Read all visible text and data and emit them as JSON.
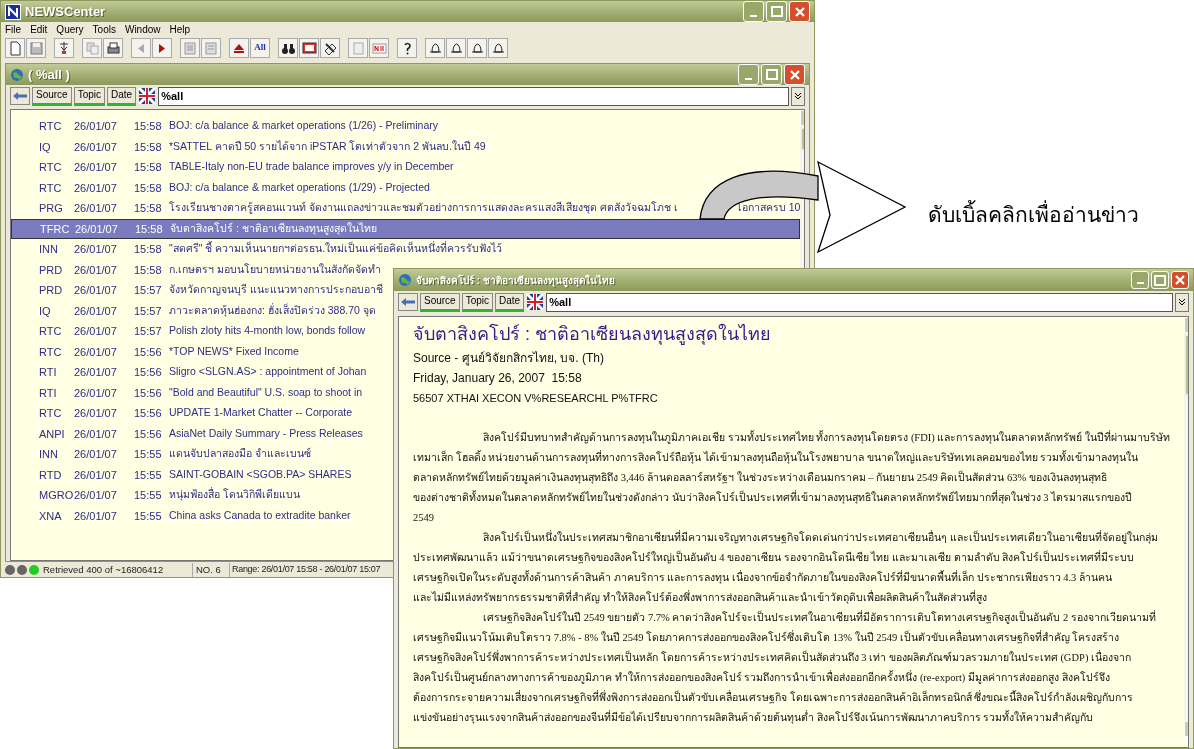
{
  "app": {
    "title": "NEWSCenter",
    "menu": [
      "File",
      "Edit",
      "Query",
      "Tools",
      "Window",
      "Help"
    ],
    "toolbar_label": "All"
  },
  "list_window": {
    "title": "( %all )",
    "filter_buttons": [
      "Source",
      "Topic",
      "Date"
    ],
    "query": "%all",
    "rows": [
      {
        "source": "RTC",
        "date": "26/01/07",
        "time": "15:58",
        "title": "BOJ: c/a balance & market operations (1/26) - Preliminary",
        "selected": false
      },
      {
        "source": "IQ",
        "date": "26/01/07",
        "time": "15:58",
        "title": "*SATTEL คาดปี 50 รายได้จาก iPSTAR โตเท่าตัวจาก 2 พันลบ.ในปี 49",
        "selected": false
      },
      {
        "source": "RTC",
        "date": "26/01/07",
        "time": "15:58",
        "title": "TABLE-Italy non-EU trade balance improves y/y in December",
        "selected": false
      },
      {
        "source": "RTC",
        "date": "26/01/07",
        "time": "15:58",
        "title": "BOJ: c/a balance & market operations (1/29) - Projected",
        "selected": false
      },
      {
        "source": "PRG",
        "date": "26/01/07",
        "time": "15:58",
        "title": "โรงเรียนชางตาครู้สคอนแวนท์ จัดงานแถลงข่าวและชมตัวอย่างการการแสดงละครแสงสีเสียงชุด ศตสังวัจฉมโภช เ",
        "title_tail": "โอกาสครบ 10",
        "selected": false
      },
      {
        "source": "TFRC",
        "date": "26/01/07",
        "time": "15:58",
        "title": "จับตาสิงคโปร์ : ชาติอาเซียนลงทุนสูงสุดในไทย",
        "selected": true
      },
      {
        "source": "INN",
        "date": "26/01/07",
        "time": "15:58",
        "title": "\"สดศรี\" ชี้ ความเห็นนายกฯต่อรธน.ใหม่เป็นแค่ข้อคิดเห็นหนึ่งที่ควรรับฟังไว้",
        "selected": false
      },
      {
        "source": "PRD",
        "date": "26/01/07",
        "time": "15:58",
        "title": "ก.เกษตรฯ มอบนโยบายหน่วยงานในสังกัดจัดทำ",
        "selected": false
      },
      {
        "source": "PRD",
        "date": "26/01/07",
        "time": "15:57",
        "title": "จังหวัดกาญจนบุรี แนะแนวทางการประกอบอาชี",
        "selected": false
      },
      {
        "source": "IQ",
        "date": "26/01/07",
        "time": "15:57",
        "title": "ภาวะตลาดหุ้นฮ่องกง: ฮั่งเส็งปิดร่วง 388.70 จุด",
        "selected": false
      },
      {
        "source": "RTC",
        "date": "26/01/07",
        "time": "15:57",
        "title": "Polish zloty hits 4-month low, bonds follow",
        "selected": false
      },
      {
        "source": "RTC",
        "date": "26/01/07",
        "time": "15:56",
        "title": "*TOP NEWS* Fixed Income",
        "selected": false
      },
      {
        "source": "RTI",
        "date": "26/01/07",
        "time": "15:56",
        "title": "Sligro <SLGN.AS> : appointment of Johan",
        "selected": false
      },
      {
        "source": "RTI",
        "date": "26/01/07",
        "time": "15:56",
        "title": "\"Bold and Beautiful\" U.S. soap to shoot in",
        "selected": false
      },
      {
        "source": "RTC",
        "date": "26/01/07",
        "time": "15:56",
        "title": "UPDATE 1-Market Chatter -- Corporate",
        "selected": false
      },
      {
        "source": "ANPI",
        "date": "26/01/07",
        "time": "15:56",
        "title": "AsiaNet Daily Summary - Press Releases",
        "selected": false
      },
      {
        "source": "INN",
        "date": "26/01/07",
        "time": "15:55",
        "title": "แดนจับปลาสองมือ จำและเบนซ์",
        "selected": false
      },
      {
        "source": "RTD",
        "date": "26/01/07",
        "time": "15:55",
        "title": "SAINT-GOBAIN <SGOB.PA> SHARES",
        "selected": false
      },
      {
        "source": "MGRO",
        "date": "26/01/07",
        "time": "15:55",
        "title": "หนุ่มฟ้องสื่อ โดนวิกิพีเดียแบน",
        "selected": false
      },
      {
        "source": "XNA",
        "date": "26/01/07",
        "time": "15:55",
        "title": "China asks Canada to extradite banker",
        "selected": false
      }
    ]
  },
  "status_bar": {
    "retrieved": "Retrieved 400 of ~16806412",
    "number": "NO. 6",
    "range": "Range: 26/01/07 15:58 - 26/01/07 15:07"
  },
  "callout": "ดับเบิ้ลคลิกเพื่ออ่านข่าว",
  "article_window": {
    "title": "จับตาสิงคโปร์ : ชาติอาเซียนลงทุนสูงสุดในไทย",
    "filter_buttons": [
      "Source",
      "Topic",
      "Date"
    ],
    "query": "%all",
    "headline": "จับตาสิงคโปร์ : ชาติอาเซียนลงทุนสูงสุดในไทย",
    "source": "Source - ศูนย์วิจัยกสิกรไทย, บจ. (Th)",
    "date": "Friday, January 26, 2007  15:58",
    "codes": "56507 XTHAI XECON V%RESEARCHL P%TFRC",
    "paragraphs": [
      {
        "lines": [
          "สิงคโปร์มีบทบาทสำคัญด้านการลงทุนในภูมิภาคเอเชีย รวมทั้งประเทศไทย ทั้งการลงทุนโดยตรง (FDI) และการลงทุนในตลาดหลักทรัพย์ ในปีที่ผ่านมาบริษัท",
          "เทมาเส็ก โฮลดิ้ง หน่วยงานด้านการลงทุนที่ทางการสิงคโปร์ถือหุ้น ได้เข้ามาลงทุนถือหุ้นในโรงพยาบาล ขนาดใหญ่และบริษัทเทเลคอมของไทย รวมทั้งเข้ามาลงทุนใน",
          "ตลาดหลักทรัพย์ไทยด้วยมูลค่าเงินลงทุนสุทธิถึง 3,446 ล้านดอลลาร์สหรัฐฯ ในช่วงระหว่างเดือนมกราคม – กันยายน 2549  คิดเป็นสัดส่วน 63% ของเงินลงทุนสุทธิ",
          "ของต่างชาติทั้งหมดในตลาดหลักทรัพย์ไทยในช่วงดังกล่าว นับว่าสิงคโปร์เป็นประเทศที่เข้ามาลงทุนสุทธิในตลาดหลักทรัพย์ไทยมากที่สุดในช่วง 3 ไตรมาสแรกของปี",
          "2549"
        ]
      },
      {
        "lines": [
          "สิงคโปร์เป็นหนึ่งในประเทศสมาชิกอาเซียนที่มีความเจริญทางเศรษฐกิจโดดเด่นกว่าประเทศอาเซียนอื่นๆ และเป็นประเทศเดียวในอาเซียนที่จัดอยู่ในกลุ่ม",
          "ประเทศพัฒนาแล้ว แม้ว่าขนาดเศรษฐกิจของสิงคโปร์ใหญ่เป็นอันดับ 4 ของอาเซียน รองจากอินโดนีเซีย ไทย และมาเลเซีย ตามลำดับ สิงคโปร์เป็นประเทศที่มีระบบ",
          "เศรษฐกิจเปิดในระดับสูงทั้งด้านการค้าสินค้า ภาคบริการ และการลงทุน เนื่องจากข้อจำกัดภายในของสิงคโปร์ที่มีขนาดพื้นที่เล็ก ประชากรเพียงราว 4.3 ล้านคน",
          "และไม่มีแหล่งทรัพยากรธรรมชาติที่สำคัญ ทำให้สิงคโปร์ต้องพึ่งพาการส่งออกสินค้าและนำเข้าวัตถุดิบเพื่อผลิตสินค้าในสัดส่วนที่สูง"
        ]
      },
      {
        "lines": [
          "เศรษฐกิจสิงคโปร์ในปี 2549 ขยายตัว 7.7% คาดว่าสิงคโปร์จะเป็นประเทศในอาเซียนที่มีอัตราการเติบโตทางเศรษฐกิจสูงเป็นอันดับ 2 รองจากเวียดนามที่",
          "เศรษฐกิจมีแนวโน้มเติบโตราว 7.8% - 8% ในปี 2549 โดยภาคการส่งออกของสิงคโปร์ซึ่งเติบโต 13% ในปี 2549 เป็นตัวขับเคลื่อนทางเศรษฐกิจที่สำคัญ โครงสร้าง",
          "เศรษฐกิจสิงคโปร์พึ่งพาการค้าระหว่างประเทศเป็นหลัก โดยการค้าระหว่างประเทศคิดเป็นสัดส่วนถึง 3 เท่า ของผลิตภัณฑ์มวลรวมภายในประเทศ (GDP) เนื่องจาก",
          "สิงคโปร์เป็นศูนย์กลางทางการค้าของภูมิภาค ทำให้การส่งออกของสิงคโปร์ รวมถึงการนำเข้าเพื่อส่งออกอีกครั้งหนึ่ง (re-export) มีมูลค่าการส่งออกสูง สิงคโปร์จึง",
          "ต้องการกระจายความเสี่ยงจากเศรษฐกิจที่พึ่งพิงการส่งออกเป็นตัวขับเคลื่อนเศรษฐกิจ โดยเฉพาะการส่งออกสินค้าอิเล็กทรอนิกส์ ซึ่งขณะนี้สิงคโปร์กำลังเผชิญกับการ",
          "แข่งขันอย่างรุนแรงจากสินค้าส่งออกของจีนที่มีข้อได้เปรียบจากการผลิตสินค้าด้วยต้นทุนต่ำ สิงคโปร์จึงเน้นการพัฒนาภาคบริการ รวมทั้งให้ความสำคัญกับ"
        ]
      }
    ]
  }
}
